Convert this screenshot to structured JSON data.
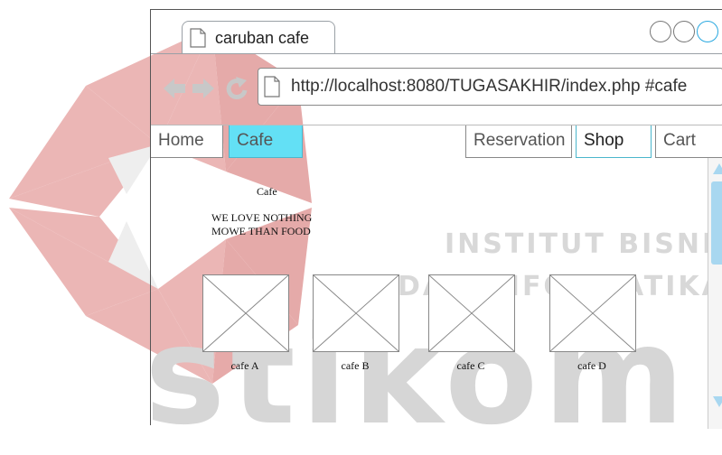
{
  "window": {
    "tab_title": "caruban cafe",
    "url": "http://localhost:8080/TUGASAKHIR/index.php #cafe"
  },
  "nav": {
    "home": "Home",
    "cafe": "Cafe",
    "reservation": "Reservation",
    "shop": "Shop",
    "cart": "Cart",
    "active": "Cafe",
    "active_color": "#63e0f5"
  },
  "content": {
    "title": "Cafe",
    "tagline_line1": "WE LOVE NOTHING",
    "tagline_line2": "MOWE THAN FOOD",
    "items": [
      {
        "label": "cafe A"
      },
      {
        "label": "cafe B"
      },
      {
        "label": "cafe C"
      },
      {
        "label": "cafe D"
      }
    ]
  },
  "watermark": {
    "line1": "INSTITUT BISNIS",
    "line2": "DAN INFORMATIKA",
    "brand": "stikom"
  },
  "icons": [
    "page-icon",
    "back-arrow-icon",
    "forward-arrow-icon",
    "reload-icon",
    "window-control-icon",
    "scroll-up-icon",
    "scroll-down-icon",
    "image-placeholder-icon"
  ]
}
